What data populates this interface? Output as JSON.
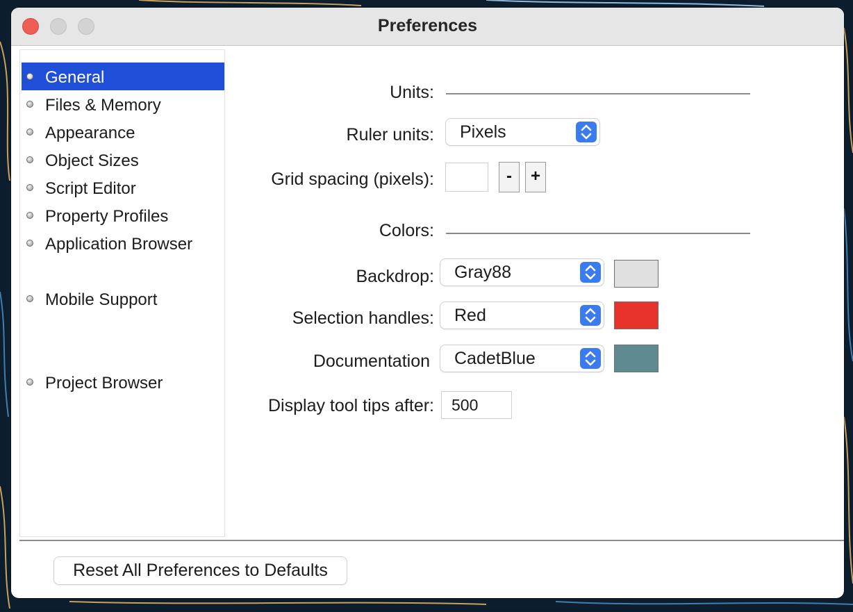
{
  "window": {
    "title": "Preferences"
  },
  "sidebar": {
    "items": [
      {
        "label": "General",
        "selected": true
      },
      {
        "label": "Files & Memory"
      },
      {
        "label": "Appearance"
      },
      {
        "label": "Object Sizes"
      },
      {
        "label": "Script Editor"
      },
      {
        "label": "Property Profiles"
      },
      {
        "label": "Application Browser"
      },
      {
        "label": "Mobile Support"
      },
      {
        "label": "Project Browser"
      }
    ]
  },
  "units": {
    "section_label": "Units:",
    "ruler_units_label": "Ruler units:",
    "ruler_units_value": "Pixels",
    "grid_spacing_label": "Grid spacing (pixels):",
    "grid_spacing_value": "",
    "decrement_label": "-",
    "increment_label": "+"
  },
  "colors": {
    "section_label": "Colors:",
    "backdrop": {
      "label": "Backdrop:",
      "value": "Gray88",
      "swatch": "#e0e0e0"
    },
    "selection_handles": {
      "label": "Selection handles:",
      "value": "Red",
      "swatch": "#e8332a"
    },
    "documentation": {
      "label": "Documentation",
      "value": "CadetBlue",
      "swatch": "#5f8a92"
    }
  },
  "tooltips": {
    "label": "Display tool tips after:",
    "value": "500"
  },
  "footer": {
    "reset_label": "Reset All Preferences to Defaults"
  },
  "theme": {
    "accent": "#1f4fd8",
    "popup_stepper": "#3a7cf0"
  }
}
